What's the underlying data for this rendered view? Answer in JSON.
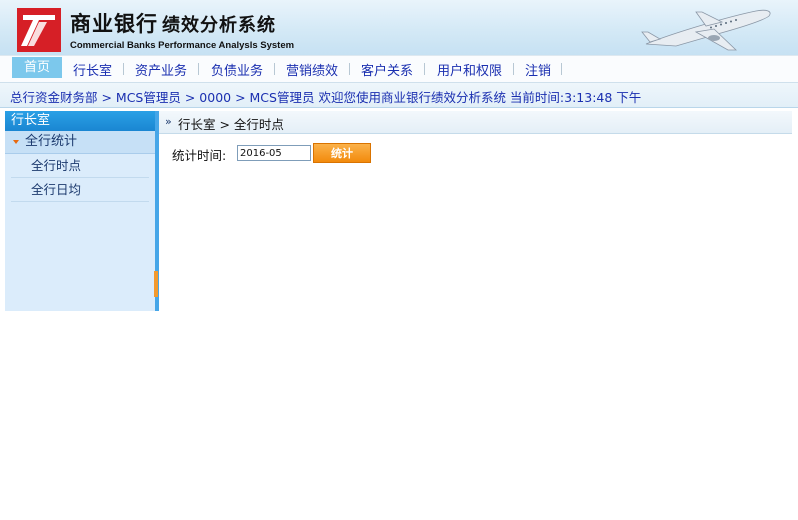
{
  "header": {
    "title_cn": "商业银行",
    "subtitle_cn": "绩效分析系统",
    "title_en": "Commercial Banks  Performance Analysls System",
    "logo_color": "#d61f26"
  },
  "nav": {
    "items": [
      {
        "label": "首页",
        "active": true
      },
      {
        "label": "行长室"
      },
      {
        "label": "资产业务"
      },
      {
        "label": "负债业务"
      },
      {
        "label": "营销绩效"
      },
      {
        "label": "客户关系"
      },
      {
        "label": "用户和权限"
      },
      {
        "label": "注销"
      }
    ]
  },
  "infobar": {
    "text": "总行资金财务部 > MCS管理员 > 0000 > MCS管理员  欢迎您使用商业银行绩效分析系统  当前时间:3:13:48 下午"
  },
  "sidebar": {
    "title": "行长室",
    "group": "全行统计",
    "items": [
      "全行时点",
      "全行日均"
    ]
  },
  "main": {
    "breadcrumb": "行长室  > 全行时点",
    "breadcrumb_icon": "double-chevron-right-icon",
    "stat_label": "统计时间:",
    "date_value": "2016-05",
    "button_label": "统计"
  }
}
